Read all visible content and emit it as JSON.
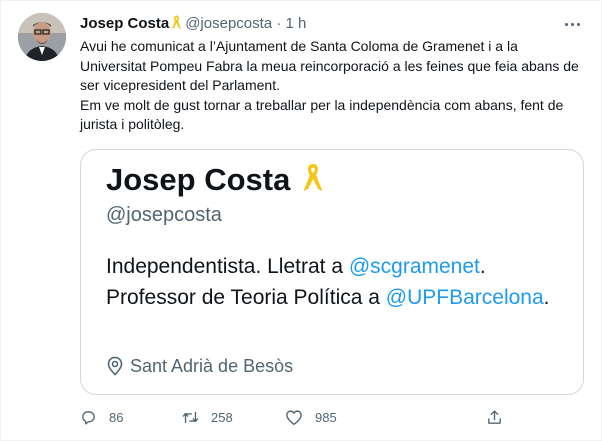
{
  "tweet": {
    "author_name": "Josep Costa",
    "author_handle": "@josepcosta",
    "separator": "·",
    "time": "1 h",
    "text_lines": [
      "Avui he comunicat a l’Ajuntament de Santa Coloma de Gramenet i a la Universitat Pompeu Fabra la meua reincorporació a les feines que feia abans de ser vicepresident del Parlament.",
      "Em ve molt de gust tornar a treballar per la independència com abans, fent de jurista i politòleg."
    ]
  },
  "card": {
    "name": "Josep Costa",
    "handle": "@josepcosta",
    "bio_prefix": "Independentista. Lletrat a ",
    "mention1": "@scgramenet",
    "bio_middle": ". Professor de Teoria Política a ",
    "mention2": "@UPFBarcelona",
    "bio_suffix": ".",
    "location": "Sant Adrià de Besòs"
  },
  "actions": {
    "replies": "86",
    "retweets": "258",
    "likes": "985"
  },
  "colors": {
    "accent": "#1d9bf0",
    "secondary_text": "#536471",
    "ribbon": "#f5c518"
  }
}
